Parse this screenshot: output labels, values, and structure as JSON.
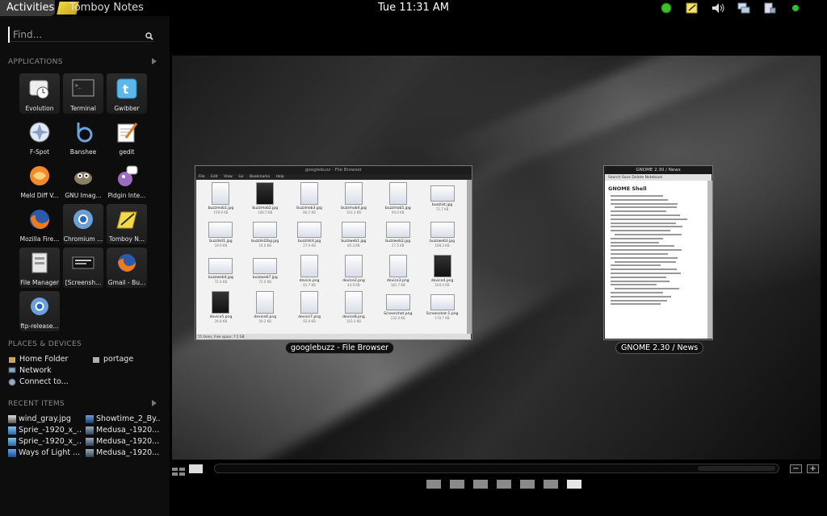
{
  "top_panel": {
    "activities": "Activities",
    "app_menu": "Tomboy Notes",
    "clock": "Tue 11:31 AM",
    "tray_icons": [
      "green-status-icon",
      "notes-icon",
      "volume-icon",
      "network-icon",
      "battery-icon",
      "user-status-icon"
    ]
  },
  "search": {
    "placeholder": "Find..."
  },
  "sections": {
    "applications": "APPLICATIONS",
    "places": "PLACES & DEVICES",
    "recent": "RECENT ITEMS"
  },
  "applications": [
    {
      "label": "Evolution",
      "icon": "evolution-icon"
    },
    {
      "label": "Terminal",
      "icon": "terminal-icon"
    },
    {
      "label": "Gwibber",
      "icon": "gwibber-icon"
    },
    {
      "label": "F-Spot",
      "icon": "fspot-icon"
    },
    {
      "label": "Banshee",
      "icon": "banshee-icon"
    },
    {
      "label": "gedit",
      "icon": "gedit-icon"
    },
    {
      "label": "Meld Diff V...",
      "icon": "meld-icon"
    },
    {
      "label": "GNU Imag...",
      "icon": "gimp-icon"
    },
    {
      "label": "Pidgin Inte...",
      "icon": "pidgin-icon"
    },
    {
      "label": "Mozilla Fire...",
      "icon": "firefox-icon"
    },
    {
      "label": "Chromium ...",
      "icon": "chromium-icon"
    },
    {
      "label": "Tomboy N...",
      "icon": "tomboy-icon"
    },
    {
      "label": "File Manager",
      "icon": "file-manager-icon"
    },
    {
      "label": "[Screensh...",
      "icon": "screenshot-icon"
    },
    {
      "label": "Gmail - Bu...",
      "icon": "gmail-firefox-icon"
    },
    {
      "label": "ftp-release...",
      "icon": "ftp-icon"
    }
  ],
  "places": [
    {
      "label": "Home Folder",
      "icon": "home-folder-icon"
    },
    {
      "label": "portage",
      "icon": "folder-icon"
    },
    {
      "label": "Network",
      "icon": "network-icon"
    },
    {
      "label": "Connect to...",
      "icon": "connect-icon"
    }
  ],
  "recent": [
    {
      "label": "wind_gray.jpg"
    },
    {
      "label": "Showtime_2_By..."
    },
    {
      "label": "Sprie_-1920_x_..."
    },
    {
      "label": "Medusa_-1920..."
    },
    {
      "label": "Sprie_-1920_x_..."
    },
    {
      "label": "Medusa_-1920..."
    },
    {
      "label": "Ways of Light ..."
    },
    {
      "label": "Medusa_-1920..."
    }
  ],
  "windows": {
    "file_browser": {
      "label": "googlebuzz - File Browser",
      "title": "googlebuzz - File Browser",
      "menu": [
        "File",
        "Edit",
        "View",
        "Go",
        "Bookmarks",
        "Help"
      ],
      "status": "55 items, Free space: 7.5 GB",
      "files": [
        {
          "name": "buzzmob1.jpg",
          "size": "159.9 KB"
        },
        {
          "name": "buzzmob2.jpg",
          "size": "106.5 KB"
        },
        {
          "name": "buzzmob3.jpg",
          "size": "86.2 KB"
        },
        {
          "name": "buzzmob4.jpg",
          "size": "103.3 KB"
        },
        {
          "name": "buzzmob5.jpg",
          "size": "94.0 KB"
        },
        {
          "name": "buzzlist.jpg",
          "size": "72.7 KB"
        },
        {
          "name": "buzzlist1.jpg",
          "size": "19.9 KB"
        },
        {
          "name": "buzzlist2bg.jpg",
          "size": "24.0 KB"
        },
        {
          "name": "buzzlist4.jpg",
          "size": "27.9 KB"
        },
        {
          "name": "buzzweb1.jpg",
          "size": "85.3 KB"
        },
        {
          "name": "buzzweb2.jpg",
          "size": "27.5 KB"
        },
        {
          "name": "buzzweb3.jpg",
          "size": "168.3 KB"
        },
        {
          "name": "buzzweb4.jpg",
          "size": "72.4 KB"
        },
        {
          "name": "buzzweb7.jpg",
          "size": "72.0 KB"
        },
        {
          "name": "device.png",
          "size": "81.7 KB"
        },
        {
          "name": "device2.png",
          "size": "43.0 KB"
        },
        {
          "name": "device3.png",
          "size": "181.7 KB"
        },
        {
          "name": "device4.png",
          "size": "104.0 KB"
        },
        {
          "name": "device5.png",
          "size": "29.8 KB"
        },
        {
          "name": "device6.png",
          "size": "59.2 KB"
        },
        {
          "name": "device7.png",
          "size": "93.9 KB"
        },
        {
          "name": "device8.png",
          "size": "103.3 KB"
        },
        {
          "name": "Screenshot.png",
          "size": "232.0 KB"
        },
        {
          "name": "Screenshot-1.png",
          "size": "170.7 KB"
        }
      ]
    },
    "news": {
      "label": "GNOME 2.30 / News",
      "title": "GNOME 2.30 / News",
      "toolbar": "Search   Save   Delete   Notebook",
      "heading": "GNOME Shell"
    }
  },
  "workspaces": {
    "count": 7,
    "current_index": 6
  },
  "zoom": {
    "minus": "−",
    "plus": "+"
  }
}
